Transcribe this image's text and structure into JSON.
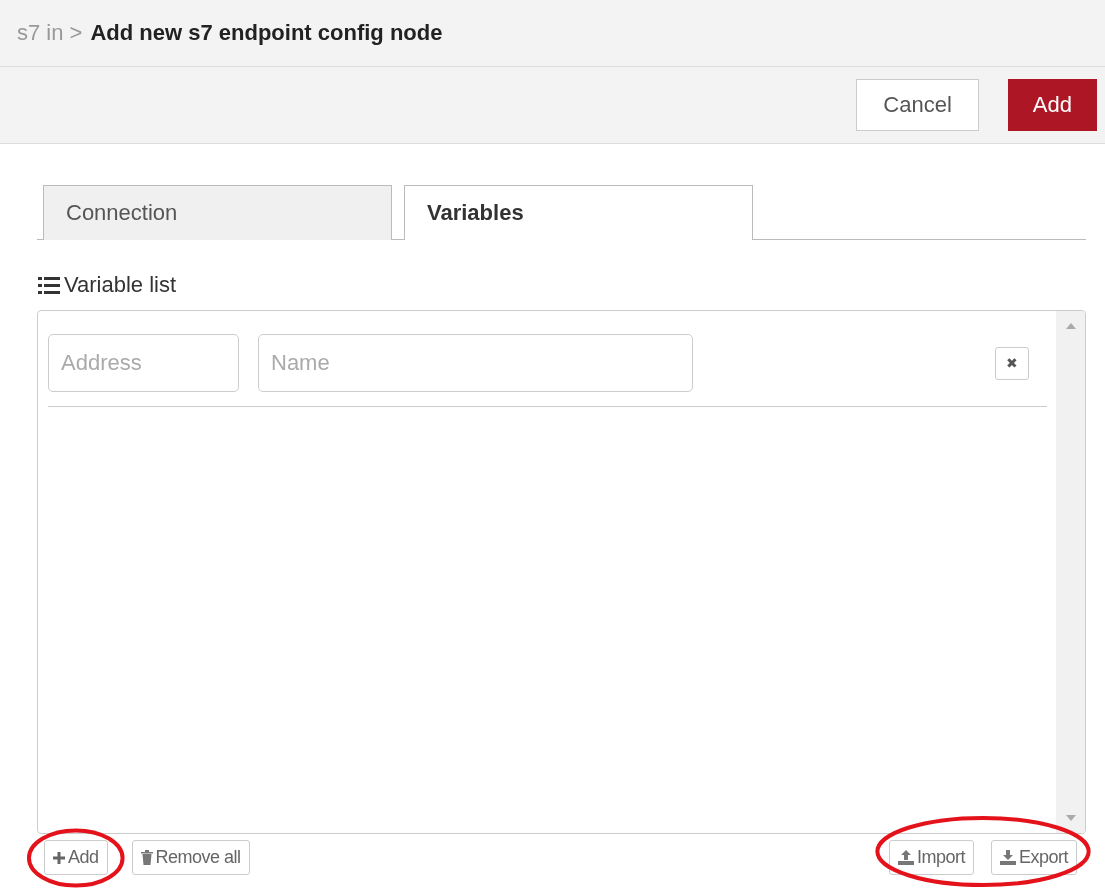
{
  "breadcrumb": {
    "parent": "s7 in >",
    "title": "Add new s7 endpoint config node"
  },
  "actions": [
    {
      "label": "Cancel",
      "kind": "secondary"
    },
    {
      "label": "Add",
      "kind": "primary"
    }
  ],
  "tabs": [
    {
      "label": "Connection",
      "selected": false
    },
    {
      "label": "Variables",
      "selected": true
    }
  ],
  "section_title": "Variable list",
  "variables": [
    {
      "address_placeholder": "Address",
      "name_placeholder": "Name",
      "remove": "✖"
    }
  ],
  "footer_left": [
    {
      "highlighted": true,
      "buttons": [
        {
          "label": "Add",
          "kind": "add"
        }
      ]
    },
    {
      "highlighted": false,
      "buttons": [
        {
          "label": "Remove all",
          "kind": "remove"
        }
      ]
    }
  ],
  "footer_right": [
    {
      "highlighted": true,
      "buttons": [
        {
          "label": "Import",
          "kind": "import"
        },
        {
          "label": "Export",
          "kind": "export"
        }
      ]
    }
  ]
}
